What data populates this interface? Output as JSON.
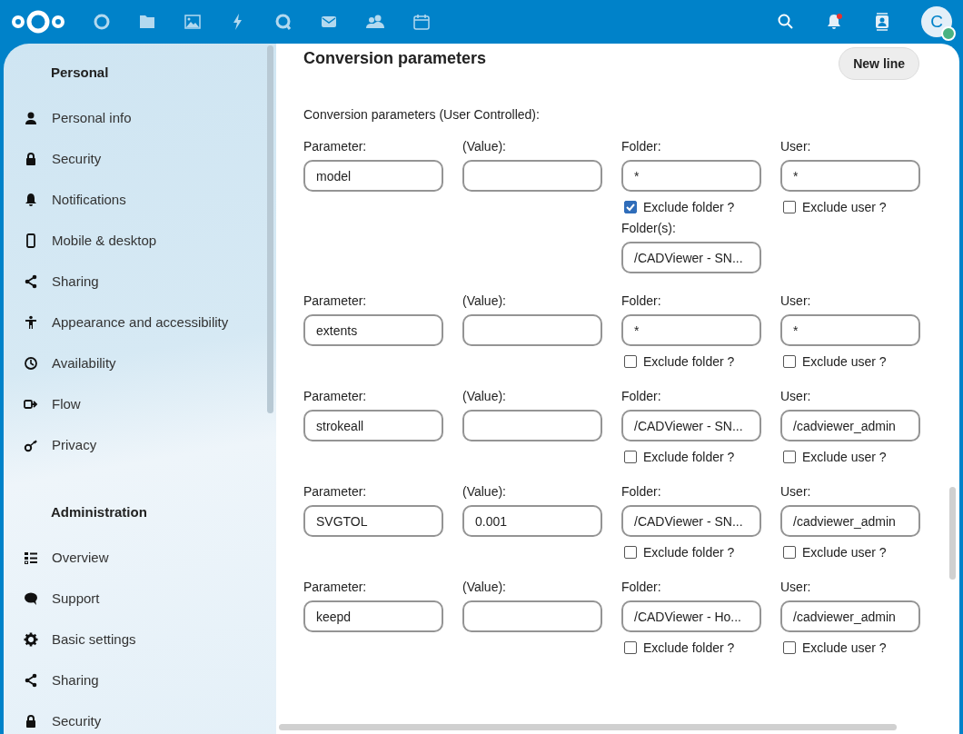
{
  "header": {
    "avatar_initial": "C",
    "notification_unread": true,
    "status_online": true
  },
  "sidebar": {
    "sections": [
      {
        "title": "Personal",
        "items": [
          {
            "label": "Personal info",
            "selected": false
          },
          {
            "label": "Security",
            "selected": false
          },
          {
            "label": "Notifications",
            "selected": false
          },
          {
            "label": "Mobile & desktop",
            "selected": false
          },
          {
            "label": "Sharing",
            "selected": false
          },
          {
            "label": "Appearance and accessibility",
            "selected": false
          },
          {
            "label": "Availability",
            "selected": false
          },
          {
            "label": "Flow",
            "selected": false
          },
          {
            "label": "Privacy",
            "selected": false
          }
        ]
      },
      {
        "title": "Administration",
        "items": [
          {
            "label": "Overview",
            "selected": false
          },
          {
            "label": "Support",
            "selected": false
          },
          {
            "label": "Basic settings",
            "selected": false
          },
          {
            "label": "Sharing",
            "selected": false
          },
          {
            "label": "Security",
            "selected": false
          }
        ]
      }
    ]
  },
  "main": {
    "title": "Conversion parameters",
    "new_line_button": "New line",
    "subtitle": "Conversion parameters (User Controlled):",
    "rows": [
      {
        "parameter_label": "Parameter:",
        "parameter": "model",
        "value_label": "(Value):",
        "value": "",
        "folder_label": "Folder:",
        "folder": "*",
        "user_label": "User:",
        "user": "*",
        "exclude_folder_label": "Exclude folder ?",
        "exclude_folder": true,
        "exclude_user_label": "Exclude user ?",
        "exclude_user": false,
        "folders_label": "Folder(s):",
        "folders": "/CADViewer - SN..."
      },
      {
        "parameter_label": "Parameter:",
        "parameter": "extents",
        "value_label": "(Value):",
        "value": "",
        "folder_label": "Folder:",
        "folder": "*",
        "user_label": "User:",
        "user": "*",
        "exclude_folder_label": "Exclude folder ?",
        "exclude_folder": false,
        "exclude_user_label": "Exclude user ?",
        "exclude_user": false
      },
      {
        "parameter_label": "Parameter:",
        "parameter": "strokeall",
        "value_label": "(Value):",
        "value": "",
        "folder_label": "Folder:",
        "folder": "/CADViewer - SN...",
        "user_label": "User:",
        "user": "/cadviewer_admin",
        "exclude_folder_label": "Exclude folder ?",
        "exclude_folder": false,
        "exclude_user_label": "Exclude user ?",
        "exclude_user": false
      },
      {
        "parameter_label": "Parameter:",
        "parameter": "SVGTOL",
        "value_label": "(Value):",
        "value": "0.001",
        "folder_label": "Folder:",
        "folder": "/CADViewer - SN...",
        "user_label": "User:",
        "user": "/cadviewer_admin",
        "exclude_folder_label": "Exclude folder ?",
        "exclude_folder": false,
        "exclude_user_label": "Exclude user ?",
        "exclude_user": false
      },
      {
        "parameter_label": "Parameter:",
        "parameter": "keepd",
        "value_label": "(Value):",
        "value": "",
        "folder_label": "Folder:",
        "folder": "/CADViewer - Ho...",
        "user_label": "User:",
        "user": "/cadviewer_admin",
        "exclude_folder_label": "Exclude folder ?",
        "exclude_folder": false,
        "exclude_user_label": "Exclude user ?",
        "exclude_user": false
      }
    ]
  }
}
